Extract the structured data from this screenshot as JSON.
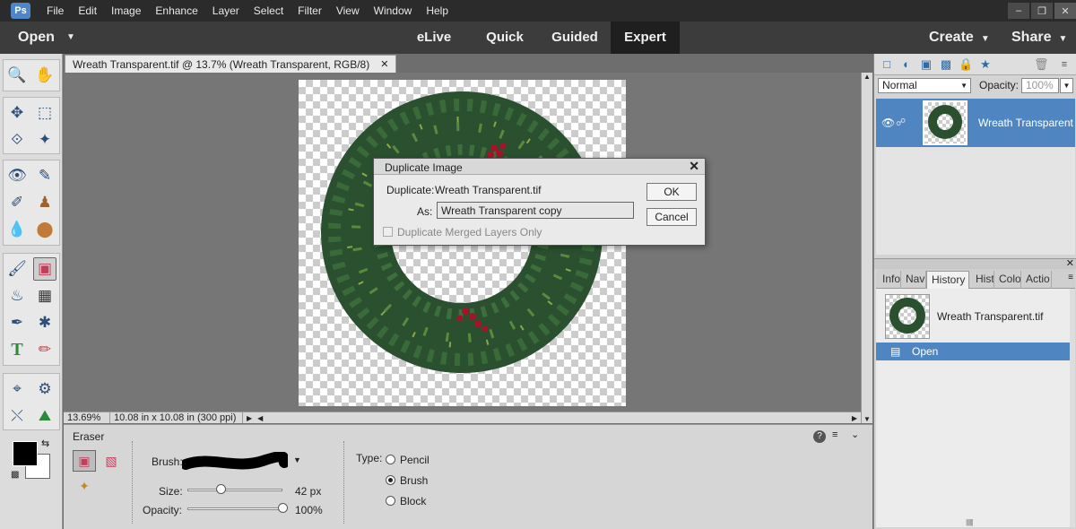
{
  "menubar": {
    "logo_label": "Ps",
    "items": [
      "File",
      "Edit",
      "Image",
      "Enhance",
      "Layer",
      "Select",
      "Filter",
      "View",
      "Window",
      "Help"
    ]
  },
  "modebar": {
    "open_label": "Open",
    "tabs": [
      "eLive",
      "Quick",
      "Guided",
      "Expert"
    ],
    "active_tab": "Expert",
    "create_label": "Create",
    "share_label": "Share"
  },
  "document": {
    "tab_title": "Wreath Transparent.tif @ 13.7% (Wreath Transparent, RGB/8)",
    "zoom": "13.69%",
    "doc_info": "10.08 in x 10.08 in (300 ppi)"
  },
  "tool_options": {
    "title": "Eraser",
    "brush_label": "Brush:",
    "size_label": "Size:",
    "size_value": "42 px",
    "size_fraction": 0.35,
    "opacity_label": "Opacity:",
    "opacity_value": "100%",
    "opacity_fraction": 1.0,
    "type_label": "Type:",
    "types": [
      "Pencil",
      "Brush",
      "Block"
    ],
    "selected_type": "Brush"
  },
  "layers": {
    "blend_mode": "Normal",
    "opacity_label": "Opacity:",
    "opacity_value": "100%",
    "layer_name": "Wreath Transparent"
  },
  "history_panel": {
    "tabs": [
      "Info",
      "Navi",
      "History",
      "Histo",
      "Colo",
      "Actio"
    ],
    "active_tab": "History",
    "snapshot_name": "Wreath Transparent.tif",
    "steps": [
      "Open"
    ]
  },
  "dialog": {
    "title": "Duplicate Image",
    "duplicate_label": "Duplicate:",
    "duplicate_value": "Wreath Transparent.tif",
    "as_label": "As:",
    "as_value": "Wreath Transparent copy",
    "merged_label": "Duplicate Merged Layers Only",
    "ok_label": "OK",
    "cancel_label": "Cancel"
  },
  "colors": {
    "accent": "#4f86c1",
    "menubar_bg": "#2b2b2b",
    "modebar_bg": "#3c3c3c",
    "foreground_color": "#000000",
    "background_color": "#ffffff"
  }
}
